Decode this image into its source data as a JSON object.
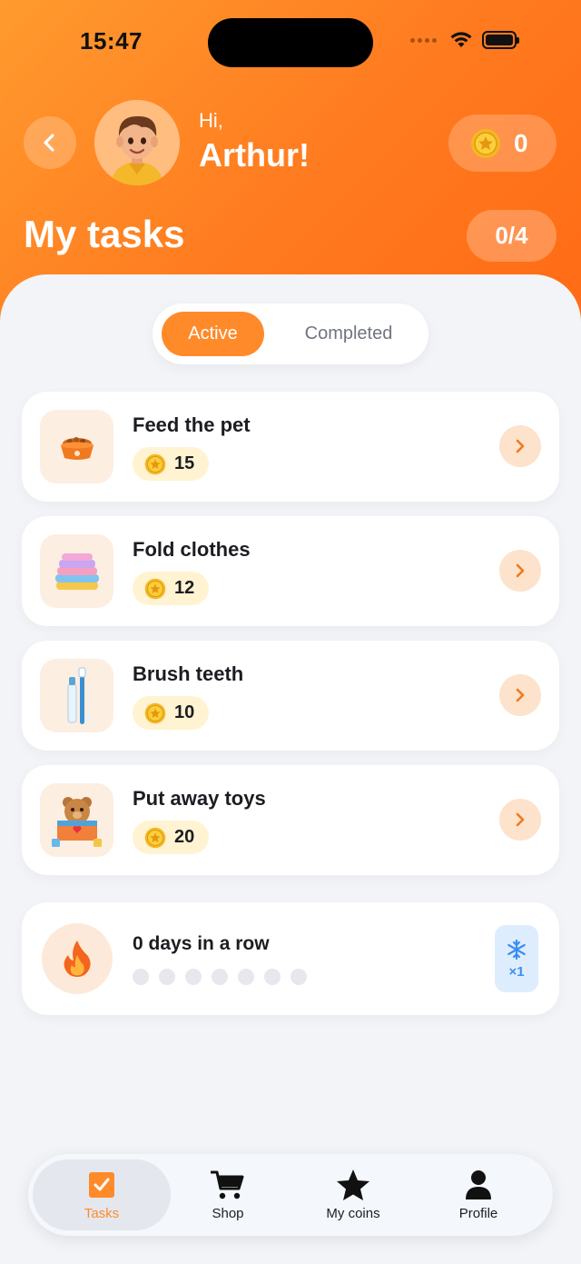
{
  "status_bar": {
    "time": "15:47"
  },
  "header": {
    "greeting": "Hi,",
    "name": "Arthur!",
    "coins": "0",
    "title": "My tasks",
    "progress": "0/4"
  },
  "segments": {
    "active": "Active",
    "completed": "Completed",
    "selected": "Active"
  },
  "tasks": [
    {
      "name": "Feed the pet",
      "reward": "15",
      "icon": "pet-bowl-icon"
    },
    {
      "name": "Fold clothes",
      "reward": "12",
      "icon": "folded-clothes-icon"
    },
    {
      "name": "Brush teeth",
      "reward": "10",
      "icon": "toothbrush-icon"
    },
    {
      "name": "Put away toys",
      "reward": "20",
      "icon": "toy-box-icon"
    }
  ],
  "streak": {
    "label": "0 days in a row",
    "days_completed": 0,
    "freeze_count": "×1"
  },
  "tabbar": {
    "tasks": "Tasks",
    "shop": "Shop",
    "my_coins": "My coins",
    "profile": "Profile",
    "selected": "Tasks"
  },
  "colors": {
    "accent": "#ff8a2a",
    "header_start": "#ff9a2e",
    "header_end": "#ff6b14",
    "coin_badge_bg": "#fff3d2",
    "freeze_bg": "#deedfd"
  }
}
